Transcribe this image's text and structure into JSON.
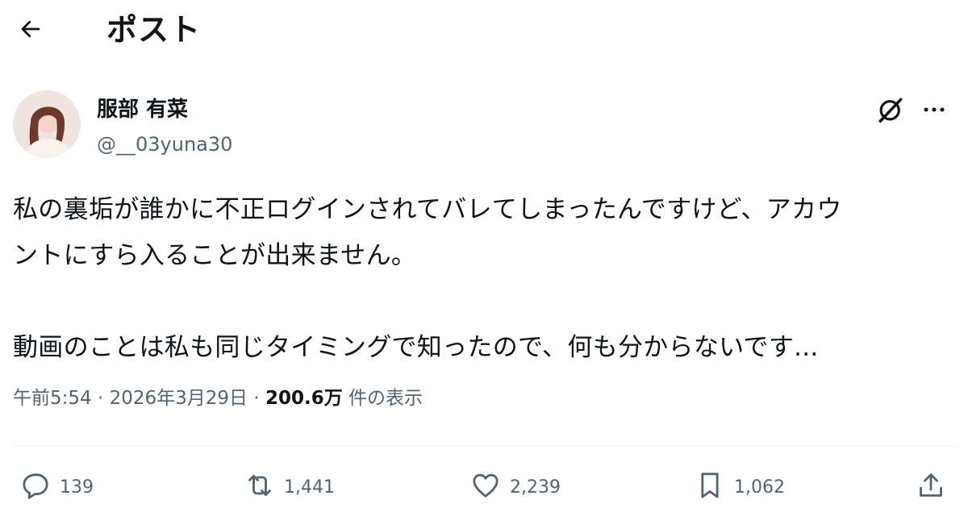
{
  "header": {
    "title": "ポスト",
    "back_icon": "arrow-left-icon"
  },
  "author": {
    "display_name": "服部 有菜",
    "handle": "@__03yuna30",
    "avatar_icon": "profile-photo"
  },
  "post": {
    "paragraph_1": "私の裏垢が誰かに不正ログインされてバレてしまったんですけど、アカウ\nントにすら入ることが出来ません。",
    "paragraph_2": "動画のことは私も同じタイミングで知ったので、何も分からないです..."
  },
  "meta": {
    "time": "午前5:54",
    "separator": " · ",
    "date": "2026年3月29日",
    "views_count": "200.6万",
    "views_label": " 件の表示"
  },
  "actions": {
    "replies": "139",
    "reposts": "1,441",
    "likes": "2,239",
    "bookmarks": "1,062"
  },
  "colors": {
    "text_primary": "#0f1419",
    "text_secondary": "#536471",
    "divider": "#eff3f4",
    "background": "#ffffff"
  }
}
